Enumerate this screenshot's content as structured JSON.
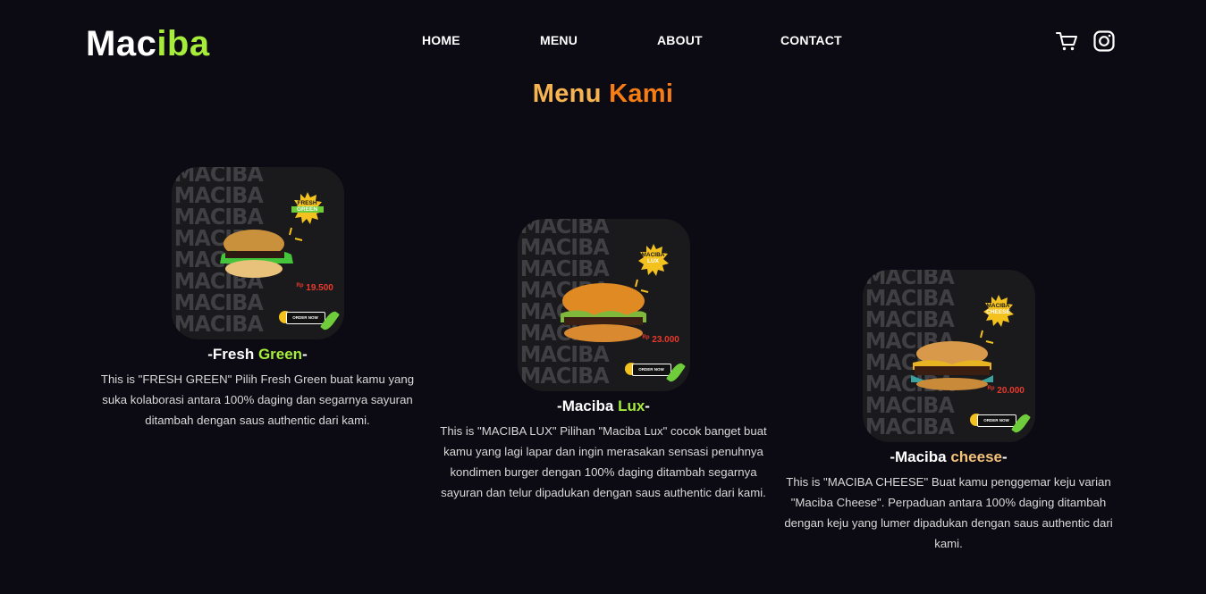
{
  "brand": {
    "part1": "Mac",
    "part2": "iba"
  },
  "nav": {
    "home": "HOME",
    "menu": "MENU",
    "about": "ABOUT",
    "contact": "CONTACT"
  },
  "icons": {
    "cart": "shopping-cart-icon",
    "instagram": "instagram-icon"
  },
  "section": {
    "title_part1": "Menu",
    "title_part2": "Kami"
  },
  "colors": {
    "background": "#0c0b13",
    "brand_green": "#a6ec3a",
    "title_light_orange": "#f5b451",
    "title_orange": "#f57d14",
    "cheese_accent": "#f5c27a"
  },
  "menu_items": [
    {
      "image_word": "MACIBA",
      "badge": [
        "FRESH",
        "GREEN"
      ],
      "price_prefix": "Rp",
      "price": "19.500",
      "order_label": "ORDER NOW",
      "name_part1": "-Fresh ",
      "name_part2": "Green",
      "name_part3": "-",
      "accent": "#a6ec3a",
      "description": "This is \"FRESH GREEN\" Pilih Fresh Green buat kamu yang suka kolaborasi antara 100% daging dan segarnya sayuran ditambah dengan saus authentic dari kami."
    },
    {
      "image_word": "MACIBA",
      "badge": [
        "MACIBA",
        "LUX"
      ],
      "price_prefix": "Rp",
      "price": "23.000",
      "order_label": "ORDER NOW",
      "name_part1": "-Maciba ",
      "name_part2": "Lux",
      "name_part3": "-",
      "accent": "#a6ec3a",
      "description": "This is \"MACIBA LUX\" Pilihan \"Maciba Lux\" cocok banget buat kamu yang lagi lapar dan ingin merasakan sensasi penuhnya kondimen burger dengan 100% daging ditambah segarnya sayuran dan telur dipadukan dengan saus authentic dari kami."
    },
    {
      "image_word": "MACIBA",
      "badge": [
        "MACIBA",
        "CHEESE"
      ],
      "price_prefix": "Rp",
      "price": "20.000",
      "order_label": "ORDER NOW",
      "name_part1": "-Maciba ",
      "name_part2": "cheese",
      "name_part3": "-",
      "accent": "#f5c27a",
      "description": "This is \"MACIBA CHEESE\" Buat kamu penggemar keju varian \"Maciba Cheese\". Perpaduan antara 100% daging ditambah dengan keju yang lumer dipadukan dengan saus authentic dari kami."
    }
  ]
}
